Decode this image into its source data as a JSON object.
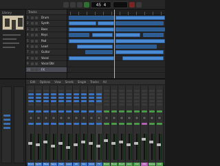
{
  "transport": {
    "position": "45 4"
  },
  "library": {
    "label": "Library"
  },
  "tracks": {
    "header": "Tracks",
    "items": [
      {
        "num": "1",
        "name": "Drum"
      },
      {
        "num": "2",
        "name": "Synth"
      },
      {
        "num": "3",
        "name": "Bass"
      },
      {
        "num": "4",
        "name": "Keys"
      },
      {
        "num": "5",
        "name": "Pad"
      },
      {
        "num": "6",
        "name": "Lead"
      },
      {
        "num": "7",
        "name": "Guitar"
      },
      {
        "num": "8",
        "name": "Vocal"
      },
      {
        "num": "9",
        "name": "Vocal Dbl"
      },
      {
        "num": "10",
        "name": "FX"
      }
    ]
  },
  "mixer": {
    "toolbar": [
      "Edit",
      "Options",
      "View",
      "Sends",
      "Single",
      "Tracks",
      "All"
    ],
    "channel_names": [
      "Drum",
      "Synth",
      "Bass",
      "Keys",
      "Pad",
      "Lead",
      "Gtr",
      "Vox",
      "Vox2",
      "FX",
      "Bus1",
      "Bus2",
      "Bus3",
      "Aux",
      "Out",
      "Mst",
      "Stereo",
      "Out"
    ]
  },
  "colors": {
    "region": "#4a8bd4",
    "accent_blue": "#3a74c4",
    "accent_green": "#4a9a4a"
  }
}
